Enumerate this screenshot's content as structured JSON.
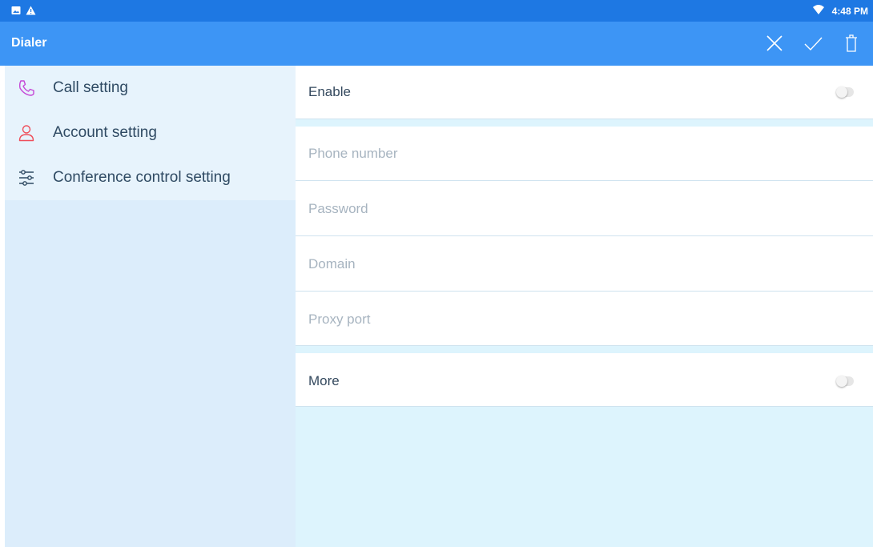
{
  "status_bar": {
    "time": "4:48 PM",
    "icons": [
      "image-notification-icon",
      "warning-icon",
      "wifi-icon"
    ]
  },
  "app_bar": {
    "title": "Dialer",
    "actions": [
      "close-icon",
      "check-icon",
      "delete-icon"
    ]
  },
  "sidebar": {
    "items": [
      {
        "label": "Call setting",
        "icon": "phone-icon",
        "icon_color": "#c548d6"
      },
      {
        "label": "Account setting",
        "icon": "person-icon",
        "icon_color": "#ef4e5a"
      },
      {
        "label": "Conference control setting",
        "icon": "sliders-icon",
        "icon_color": "#2f4a63"
      }
    ]
  },
  "form": {
    "enable_label": "Enable",
    "enable_on": false,
    "phone_placeholder": "Phone number",
    "password_placeholder": "Password",
    "domain_placeholder": "Domain",
    "proxy_port_placeholder": "Proxy port",
    "more_label": "More",
    "more_on": false
  },
  "colors": {
    "status_bar": "#1e78e3",
    "app_bar": "#3d95f5",
    "sidebar_bg": "#dcedfb",
    "content_bg": "#ddf4fd"
  }
}
